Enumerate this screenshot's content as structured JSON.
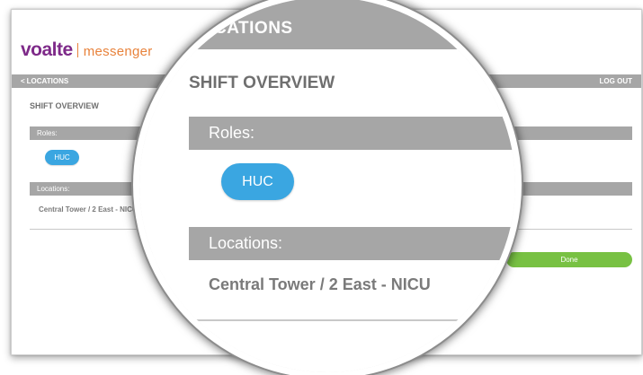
{
  "brand": {
    "name": "voalte",
    "product": "messenger",
    "primary_color": "#7e2a89",
    "accent_color": "#e8823b"
  },
  "nav": {
    "back_chevron": "<",
    "back_label": "LOCATIONS",
    "logout_label": "LOG OUT",
    "bar_color": "#a6a6a6"
  },
  "page": {
    "title": "SHIFT OVERVIEW"
  },
  "roles": {
    "header": "Roles:",
    "items": [
      "HUC"
    ],
    "pill_color": "#3aa6e1"
  },
  "locations": {
    "header": "Locations:",
    "items": [
      "Central Tower / 2 East - NICU"
    ]
  },
  "actions": {
    "done_label": "Done",
    "done_color": "#78c143"
  },
  "magnifier": {
    "top_label": "CATIONS",
    "title": "SHIFT OVERVIEW",
    "roles_header": "Roles:",
    "role": "HUC",
    "locations_header": "Locations:",
    "location": "Central Tower / 2 East - NICU"
  }
}
